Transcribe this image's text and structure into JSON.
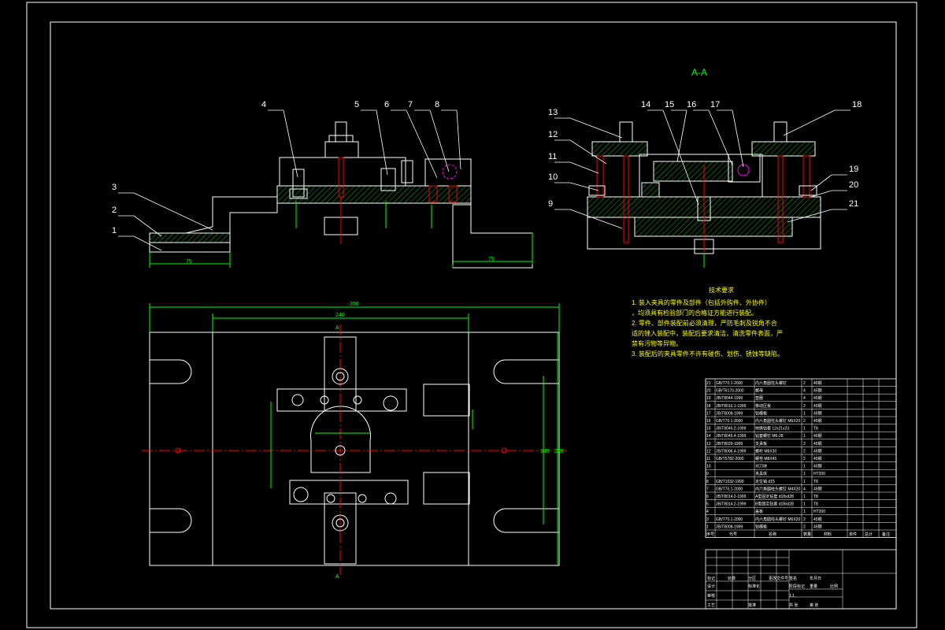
{
  "section_title": "A-A",
  "balloons_left": [
    "1",
    "2",
    "3",
    "4",
    "5",
    "6",
    "7",
    "8"
  ],
  "balloons_right": [
    "9",
    "10",
    "11",
    "12",
    "13",
    "14",
    "15",
    "16",
    "17",
    "18",
    "19",
    "20",
    "21"
  ],
  "dims": {
    "d75_left": "75",
    "d75_right": "75",
    "d390": "390",
    "d240": "240",
    "d140": "140",
    "d220": "220",
    "section_mark": "A"
  },
  "notes": {
    "title": "技术要求",
    "lines": [
      "1. 装入夹具的零件及部件（包括外购件、外协件）",
      "，均须具有检验部门的合格证方能进行装配。",
      "2. 零件、部件装配前必须清理，严防毛刺及锐角不合",
      "适的锉入装配中，装配后要求清洁，清洗零件表面，严",
      "禁有污物等异物。",
      "3. 装配后的夹具零件不许有碰伤、划伤、锈蚀等缺陷。"
    ]
  },
  "bom": [
    {
      "no": "21",
      "code": "GB/T70.1-2000",
      "name": "内六角圆柱头螺钉",
      "qty": "2",
      "mat": "45钢"
    },
    {
      "no": "20",
      "code": "GB/T6170-2000",
      "name": "螺母",
      "qty": "4",
      "mat": "45钢"
    },
    {
      "no": "19",
      "code": "JB/T8044-1999",
      "name": "垫圈",
      "qty": "4",
      "mat": "45钢"
    },
    {
      "no": "18",
      "code": "JB/T8010.1-1999",
      "name": "移动压板",
      "qty": "2",
      "mat": "45钢"
    },
    {
      "no": "17",
      "code": "JB/T8008-1999",
      "name": "钻模板",
      "qty": "1",
      "mat": "45钢"
    },
    {
      "no": "16",
      "code": "GB/T70.1-2000",
      "name": "内六角圆柱头螺钉 M6X20",
      "qty": "2",
      "mat": "45钢"
    },
    {
      "no": "15",
      "code": "JB/T8045.2-1999",
      "name": "快换钻套 12x21x23",
      "qty": "1",
      "mat": "T8"
    },
    {
      "no": "14",
      "code": "JB/T8045.4-1999",
      "name": "钻套螺钉 M6-28",
      "qty": "1",
      "mat": "45钢"
    },
    {
      "no": "13",
      "code": "JB/T8029-1999",
      "name": "支承板",
      "qty": "2",
      "mat": "45钢"
    },
    {
      "no": "12",
      "code": "JB/T8006.4-1999",
      "name": "螺杆 M8X30",
      "qty": "2",
      "mat": "45钢"
    },
    {
      "no": "11",
      "code": "GB/T5782-2000",
      "name": "螺栓 M8X45",
      "qty": "2",
      "mat": "45钢"
    },
    {
      "no": "10",
      "code": "",
      "name": "对刀块",
      "qty": "1",
      "mat": "45钢"
    },
    {
      "no": "9",
      "code": "",
      "name": "夹具体",
      "qty": "1",
      "mat": "HT200"
    },
    {
      "no": "8",
      "code": "GB/T1032-1999",
      "name": "定位销 d15",
      "qty": "1",
      "mat": "T8"
    },
    {
      "no": "7",
      "code": "GB/T70.1-2000",
      "name": "内六角圆柱头螺钉 M4X20",
      "qty": "4",
      "mat": "45钢"
    },
    {
      "no": "6",
      "code": "JB/T8014.2-1999",
      "name": "A型固定钻套 d18xd28",
      "qty": "1",
      "mat": "T8"
    },
    {
      "no": "5",
      "code": "JB/T8014.2-1999",
      "name": "B型固定钻套 d18xd28",
      "qty": "1",
      "mat": "T8"
    },
    {
      "no": "4",
      "code": "",
      "name": "盖板",
      "qty": "1",
      "mat": "HT200"
    },
    {
      "no": "3",
      "code": "GB/T70.1-2000",
      "name": "内六角圆柱头螺钉 M6X20",
      "qty": "2",
      "mat": "45钢"
    },
    {
      "no": "1",
      "code": "JB/T8008-1999",
      "name": "钻模板",
      "qty": "2",
      "mat": "45钢"
    }
  ],
  "bom_header": [
    "序号",
    "代号",
    "名称",
    "数量",
    "材料",
    "单件",
    "总计",
    "备注"
  ],
  "title_block": {
    "r1": [
      "标记",
      "处数",
      "分区",
      "更改文件号",
      "签名",
      "年月日"
    ],
    "r2": [
      "设计",
      "",
      "标准化",
      "",
      "阶段标记",
      "重量",
      "比例"
    ],
    "r3": [
      "审核",
      "",
      "",
      "",
      "1:1"
    ],
    "r4": [
      "工艺",
      "",
      "批准",
      "",
      "共 张",
      "第 张"
    ]
  }
}
